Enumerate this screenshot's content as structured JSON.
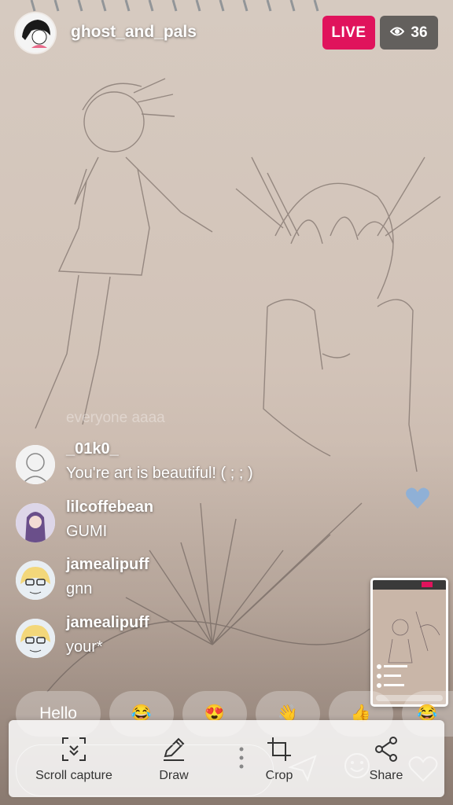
{
  "header": {
    "host_name": "ghost_and_pals",
    "live_label": "LIVE",
    "viewer_count": "36",
    "viewer_icon": "eye-icon"
  },
  "chat": {
    "faded_message": "everyone aaaa",
    "messages": [
      {
        "user": "_01k0_",
        "text": "You're art is beautiful! ( ; ; )"
      },
      {
        "user": "lilcoffebean",
        "text": "GUMI"
      },
      {
        "user": "jamealipuff",
        "text": "gnn"
      },
      {
        "user": "jamealipuff",
        "text": "your*"
      }
    ]
  },
  "quick_replies": [
    "Hello",
    "😂",
    "😍",
    "👋",
    "👍",
    "😂"
  ],
  "toolbar": {
    "scroll_capture": "Scroll capture",
    "draw": "Draw",
    "crop": "Crop",
    "share": "Share"
  },
  "colors": {
    "live_badge": "#e0135c",
    "heart": "#8fb0d6",
    "toolbar_bg": "#fafafa"
  }
}
